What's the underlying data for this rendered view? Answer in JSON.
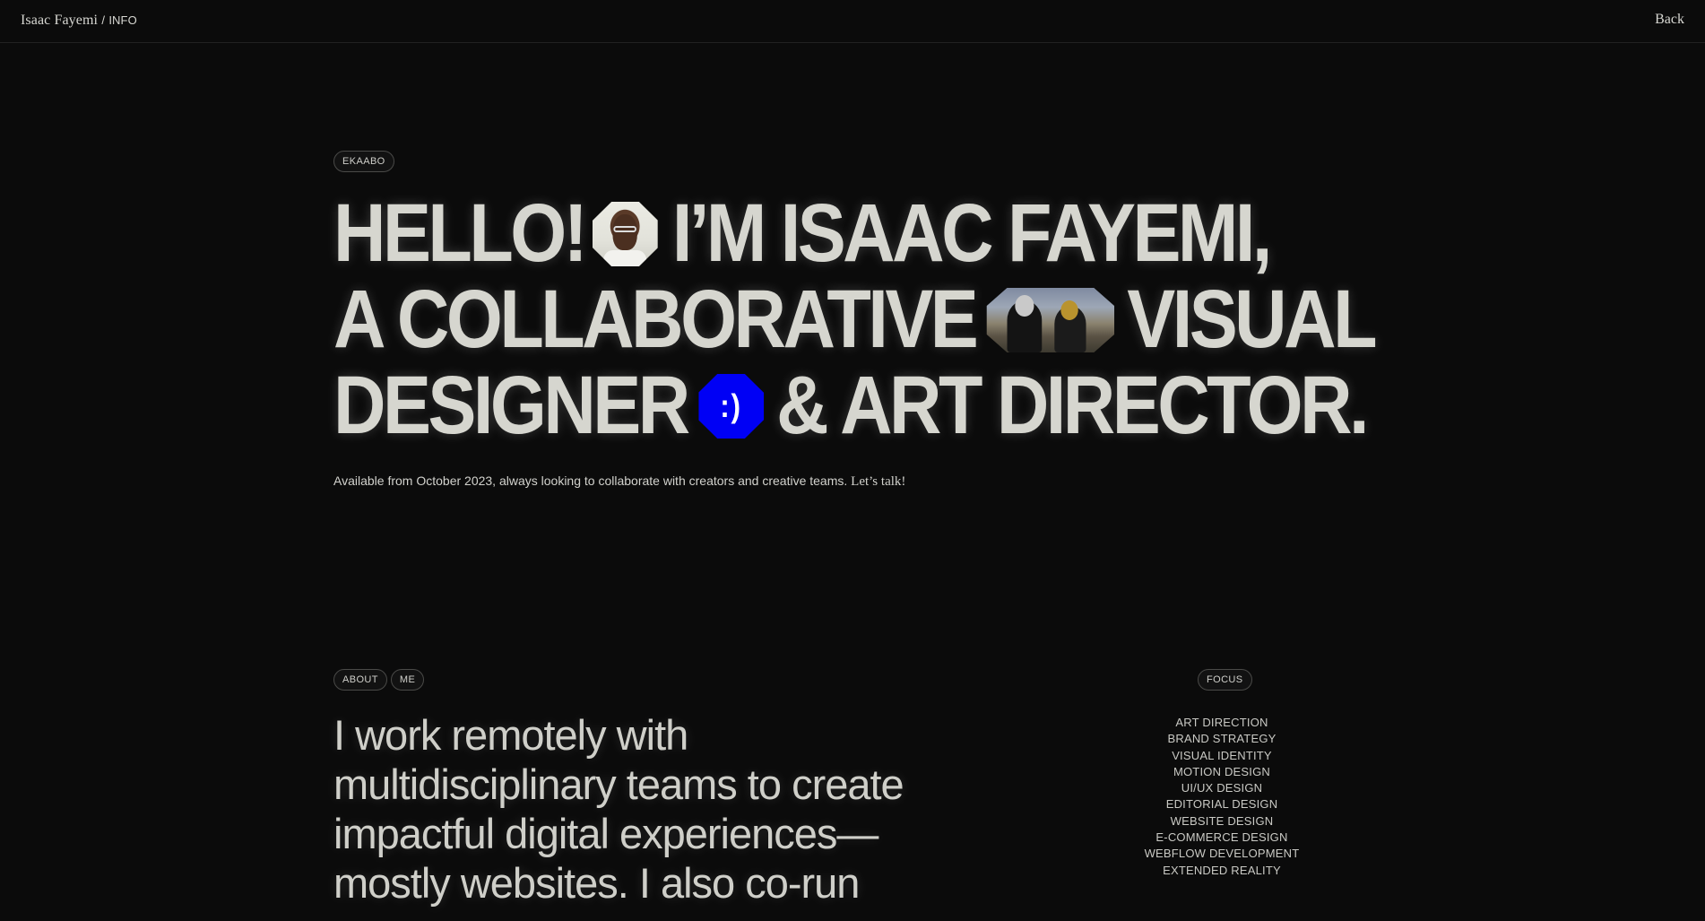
{
  "nav": {
    "name": "Isaac Fayemi",
    "separator": "/",
    "section": "INFO",
    "back_label": "Back"
  },
  "hero": {
    "tag": "EKAABO",
    "line1_a": "HELLO!",
    "line1_b": "I’M ISAAC FAYEMI,",
    "line2_a": "A COLLABORATIVE",
    "line2_b": "VISUAL",
    "line3_a": "DESIGNER",
    "line3_b": "& ART DIRECTOR.",
    "smile_text": ":)",
    "smile_color": "#0000f5",
    "availability": "Available from October 2023, always looking to collaborate with creators and creative teams.",
    "cta": "Let’s talk!"
  },
  "about": {
    "chips": [
      "ABOUT",
      "ME"
    ],
    "text": "I work remotely with multidisciplinary teams to create impactful digital experiences—mostly websites. I also co-run"
  },
  "focus": {
    "label": "FOCUS",
    "items": [
      "ART DIRECTION",
      "BRAND STRATEGY",
      "VISUAL IDENTITY",
      "MOTION DESIGN",
      "UI/UX DESIGN",
      "EDITORIAL DESIGN",
      "WEBSITE DESIGN",
      "E-COMMERCE DESIGN",
      "WEBFLOW DEVELOPMENT",
      "EXTENDED REALITY"
    ]
  }
}
